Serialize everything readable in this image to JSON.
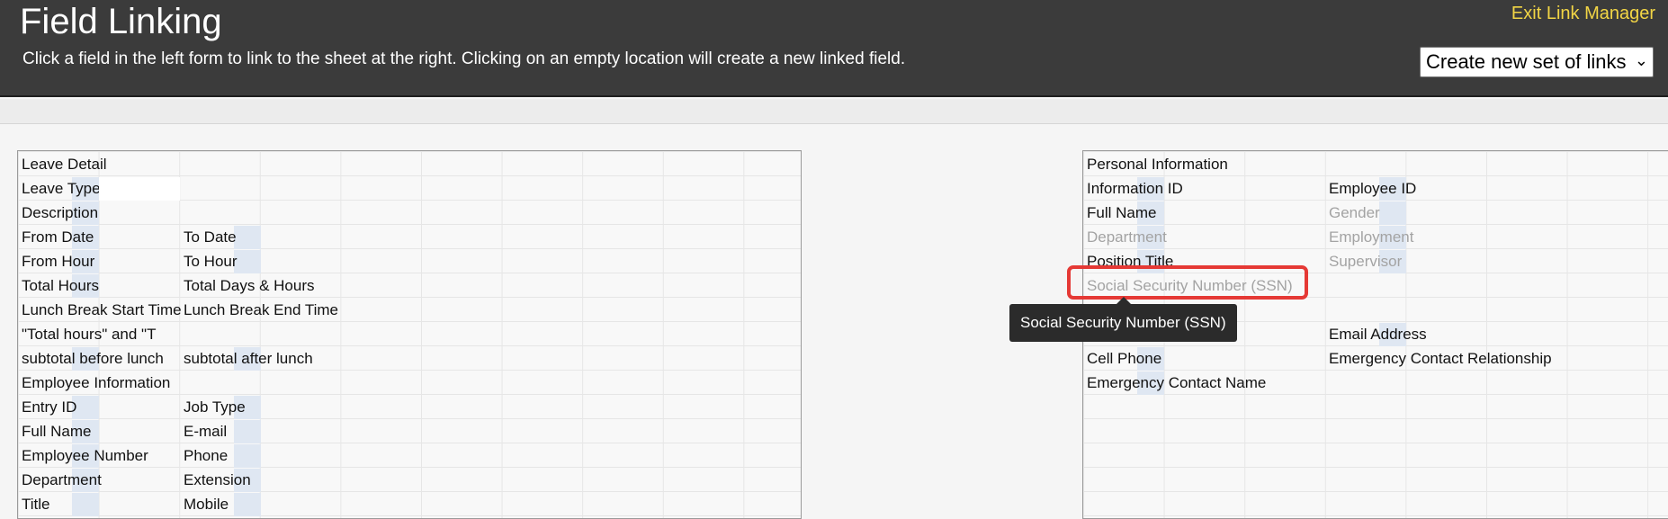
{
  "header": {
    "title": "Field Linking",
    "description": "Click a field in the left form to link to the sheet at the right. Clicking on an empty location will create a new linked field.",
    "exit_label": "Exit Link Manager",
    "set_select_value": "Create new set of links"
  },
  "left_sheet": {
    "cells": [
      "Leave Detail",
      "Leave Type",
      "Description",
      "From Date",
      "To Date",
      "From Hour",
      "To Hour",
      "Total Hours",
      "Total Days & Hours",
      "Lunch Break Start Time",
      "Lunch Break End Time",
      "\"Total hours\" and \"T",
      "subtotal before lunch",
      "subtotal after lunch",
      "Employee Information",
      "Entry ID",
      "Job Type",
      "Full Name",
      "E-mail",
      "Employee Number",
      "Phone",
      "Department",
      "Extension",
      "Title",
      "Mobile"
    ]
  },
  "right_sheet": {
    "cells": [
      "Personal Information",
      "Information ID",
      "Employee ID",
      "Full Name",
      "Gender",
      "Department",
      "Employment",
      "Position Title",
      "Supervisor",
      "Social Security Number (SSN)",
      "Email Address",
      "Cell Phone",
      "Emergency Contact Relationship",
      "Emergency Contact Name"
    ]
  },
  "tooltip": {
    "text": "Social Security Number (SSN)"
  },
  "colors": {
    "header_bg": "#3b3b3b",
    "exit_link": "#f2d545",
    "highlight": "#e53935",
    "tooltip_bg": "#2b2b2b"
  }
}
